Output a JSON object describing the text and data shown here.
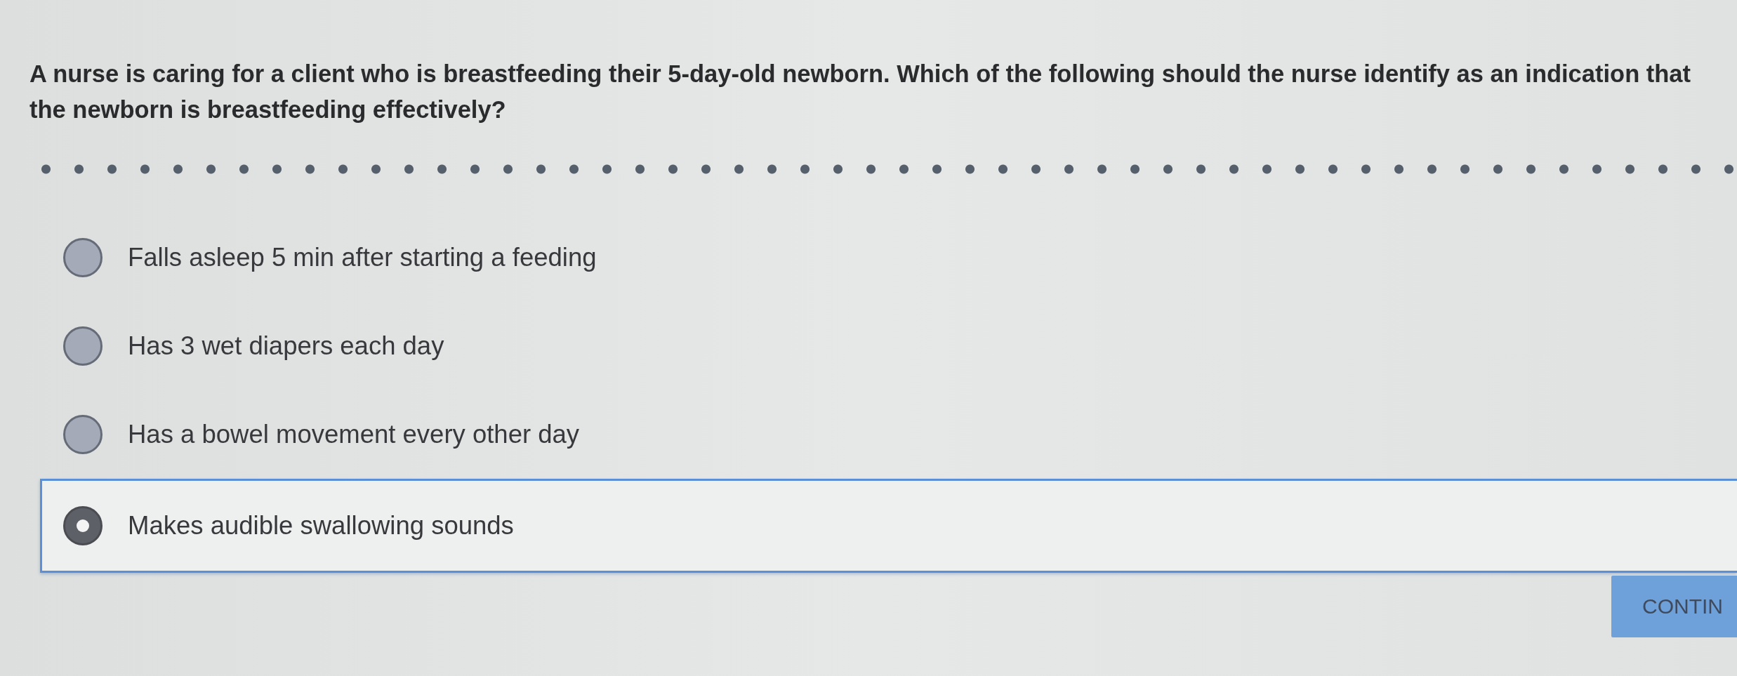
{
  "question": "A nurse is caring for a client who is breastfeeding their 5-day-old newborn. Which of the following should the nurse identify as an indication that the newborn is breastfeeding effectively?",
  "options": [
    {
      "label": "Falls asleep 5 min after starting a feeding",
      "selected": false
    },
    {
      "label": "Has 3 wet diapers each day",
      "selected": false
    },
    {
      "label": "Has a bowel movement every other day",
      "selected": false
    },
    {
      "label": "Makes audible swallowing sounds",
      "selected": true
    }
  ],
  "continue_button": {
    "label": "CONTIN"
  }
}
